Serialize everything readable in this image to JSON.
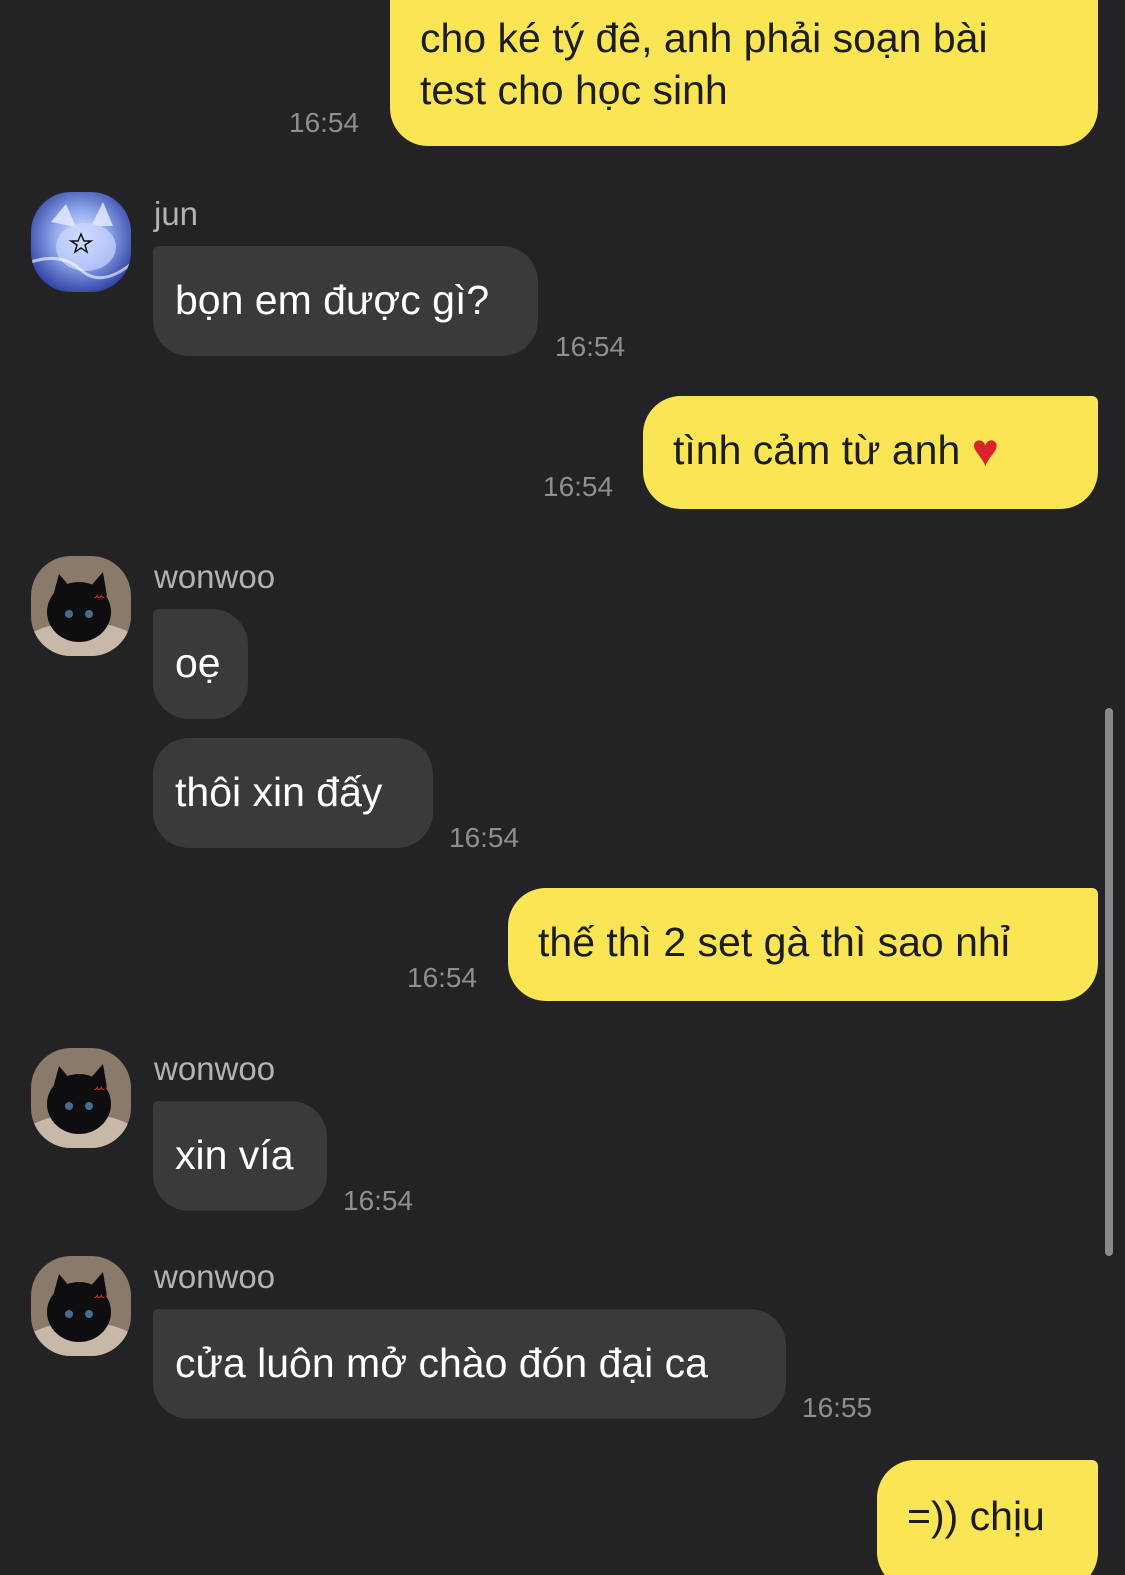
{
  "messages": [
    {
      "direction": "outgoing",
      "text_line1": "cho ké tý đê, anh phải soạn bài",
      "text_line2": "test cho học sinh",
      "time": "16:54"
    },
    {
      "direction": "incoming",
      "sender": "jun",
      "text": "bọn em được gì?",
      "time": "16:54"
    },
    {
      "direction": "outgoing",
      "text": "tình cảm từ anh",
      "emoji": "♥",
      "time": "16:54"
    },
    {
      "direction": "incoming",
      "sender": "wonwoo",
      "text": "oẹ"
    },
    {
      "direction": "incoming",
      "text": "thôi xin đấy",
      "time": "16:54"
    },
    {
      "direction": "outgoing",
      "text": "thế thì 2 set gà thì sao nhỉ",
      "time": "16:54"
    },
    {
      "direction": "incoming",
      "sender": "wonwoo",
      "text": "xin vía",
      "time": "16:54"
    },
    {
      "direction": "incoming",
      "sender": "wonwoo",
      "text": "cửa luôn mở chào đón đại ca",
      "time": "16:55"
    },
    {
      "direction": "outgoing",
      "text": "=)) chịu"
    }
  ],
  "colors": {
    "background": "#232325",
    "outgoing_bubble": "#fae655",
    "incoming_bubble": "#3a3a3c",
    "timestamp": "#8e8e93",
    "sender_name": "#b3b3b7"
  },
  "icons": {
    "avatar_jun": "avatar-blue-cat-icon",
    "avatar_wonwoo": "avatar-black-cat-icon",
    "heart": "heart-icon"
  }
}
